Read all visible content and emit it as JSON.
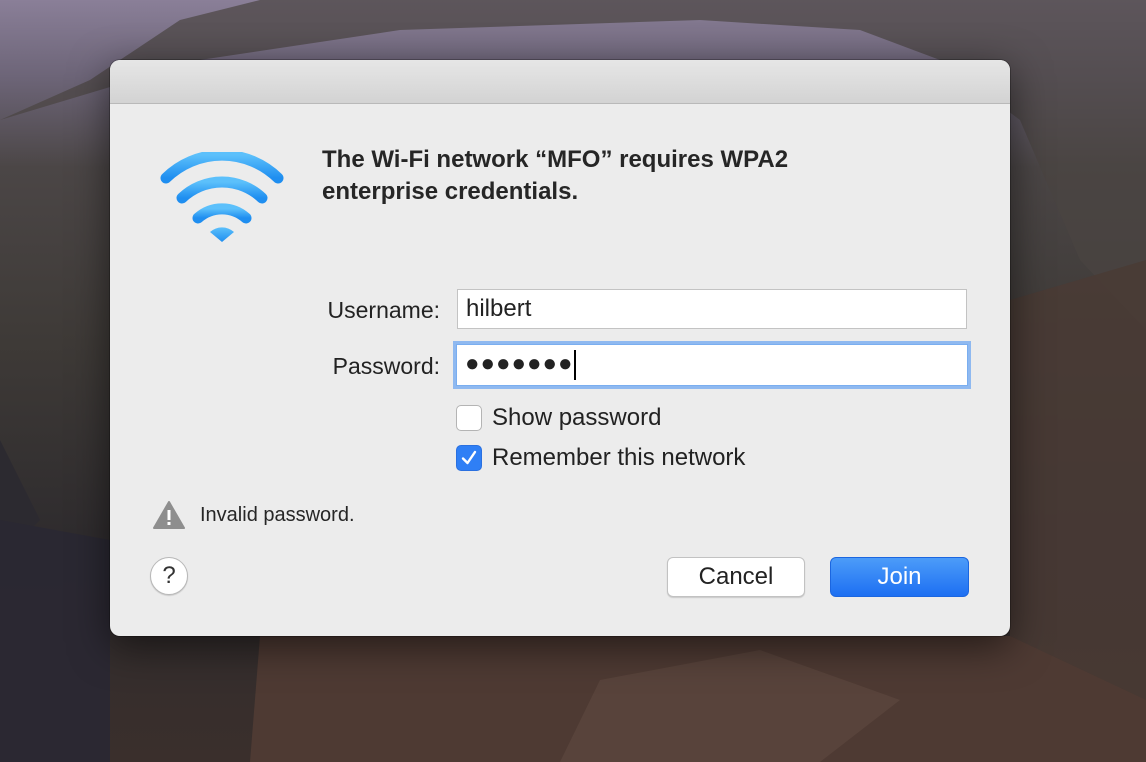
{
  "dialog": {
    "message": "The Wi-Fi network “MFO” requires WPA2 enterprise credentials.",
    "username_label": "Username:",
    "username_value": "hilbert",
    "password_label": "Password:",
    "password_value": "●●●●●●●",
    "show_password_label": "Show password",
    "show_password_checked": false,
    "remember_label": "Remember this network",
    "remember_checked": true,
    "error_text": "Invalid password.",
    "help_label": "?",
    "cancel_label": "Cancel",
    "join_label": "Join"
  },
  "icons": {
    "wifi": "wifi-icon",
    "warning": "warning-icon",
    "checkmark": "checkmark-icon"
  },
  "colors": {
    "accent": "#2f7ff5",
    "wifi_blue": "#3aa8f5",
    "focus_ring": "#8fb9f0"
  }
}
